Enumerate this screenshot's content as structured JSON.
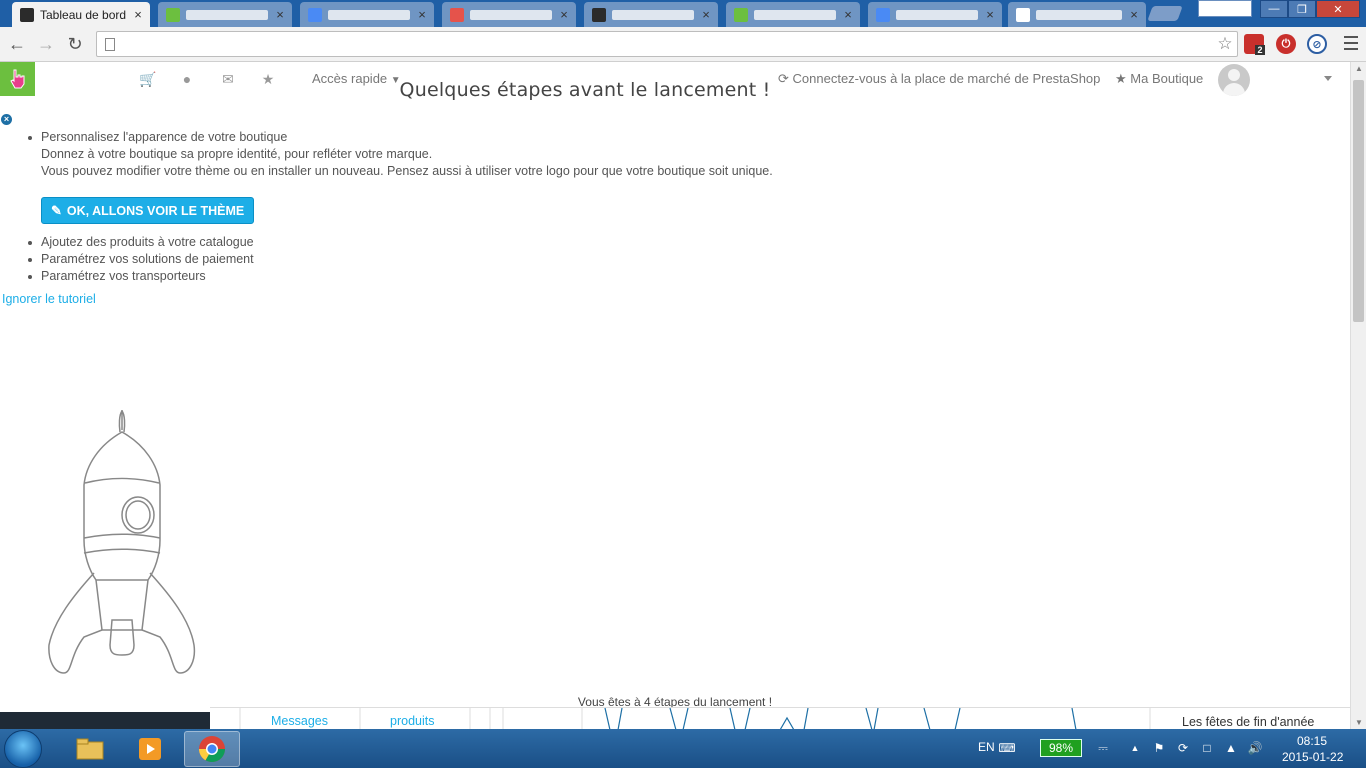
{
  "browser": {
    "tabs": [
      {
        "title": "Tableau de bord",
        "active": true,
        "favicon_color": "#2b2b2b"
      },
      {
        "title": "",
        "active": false,
        "favicon_color": "#6cbf3f"
      },
      {
        "title": "",
        "active": false,
        "favicon_color": "#4a8af4"
      },
      {
        "title": "",
        "active": false,
        "favicon_color": "#e5534b"
      },
      {
        "title": "",
        "active": false,
        "favicon_color": "#2b2b2b"
      },
      {
        "title": "",
        "active": false,
        "favicon_color": "#6cbf3f"
      },
      {
        "title": "",
        "active": false,
        "favicon_color": "#4a8af4"
      },
      {
        "title": "",
        "active": false,
        "favicon_color": "#ffffff"
      }
    ],
    "close_glyph": "×",
    "url": "",
    "extension_badge": "2"
  },
  "admin_header": {
    "quick_access": "Accès rapide",
    "marketplace_link": "Connectez-vous à la place de marché de PrestaShop",
    "shop_link": "Ma Boutique"
  },
  "tutorial": {
    "title": "Quelques étapes avant le lancement !",
    "steps": [
      {
        "title": "Personnalisez l'apparence de votre boutique",
        "line1": "Donnez à votre boutique sa propre identité, pour refléter votre marque.",
        "line2": "Vous pouvez modifier votre thème ou en installer un nouveau. Pensez aussi à utiliser votre logo pour que votre boutique soit unique.",
        "button": "OK, ALLONS VOIR LE THÈME"
      },
      {
        "title": "Ajoutez des produits à votre catalogue"
      },
      {
        "title": "Paramétrez vos solutions de paiement"
      },
      {
        "title": "Paramétrez vos transporteurs"
      }
    ],
    "skip": "Ignorer le tutoriel",
    "progress": "Vous êtes à 4 étapes du lancement !"
  },
  "dashboard_peek": {
    "messages": "Messages",
    "products": "produits",
    "right_text": "Les fêtes de fin d'année"
  },
  "taskbar": {
    "lang": "EN",
    "battery": "98%",
    "time": "08:15",
    "date": "2015-01-22"
  },
  "colors": {
    "accent": "#1daee7",
    "logo_green": "#6cbf3f",
    "taskbar": "#1f5fa6"
  }
}
